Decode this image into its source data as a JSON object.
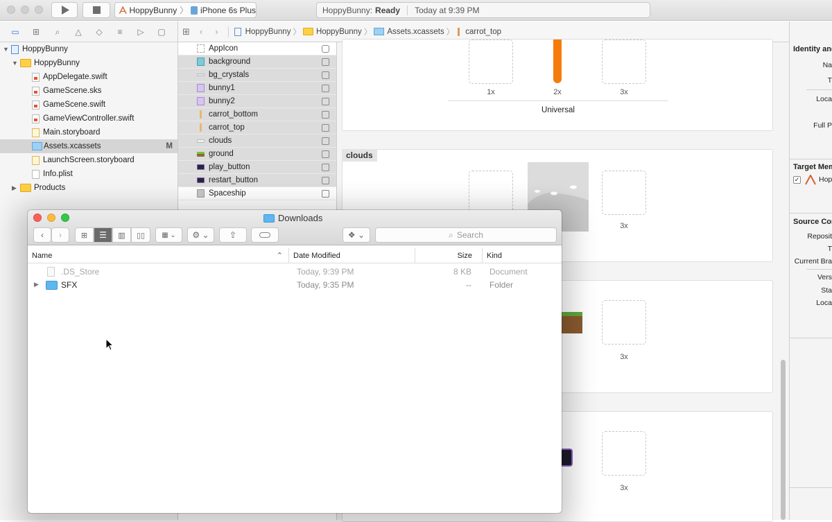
{
  "titlebar": {
    "scheme_app": "HoppyBunny",
    "scheme_device": "iPhone 6s Plus",
    "status_app": "HoppyBunny:",
    "status_state": "Ready",
    "status_time": "Today at 9:39 PM"
  },
  "jumpbar": {
    "crumbs": [
      "HoppyBunny",
      "HoppyBunny",
      "Assets.xcassets",
      "carrot_top"
    ]
  },
  "navigator": {
    "project": "HoppyBunny",
    "group": "HoppyBunny",
    "files": [
      "AppDelegate.swift",
      "GameScene.sks",
      "GameScene.swift",
      "GameViewController.swift",
      "Main.storyboard",
      "Assets.xcassets",
      "LaunchScreen.storyboard",
      "Info.plist"
    ],
    "selected_badge": "M",
    "products": "Products"
  },
  "assets": {
    "items": [
      "AppIcon",
      "background",
      "bg_crystals",
      "bunny1",
      "bunny2",
      "carrot_bottom",
      "carrot_top",
      "clouds",
      "ground",
      "play_button",
      "restart_button",
      "Spaceship"
    ]
  },
  "detail": {
    "slot_1x": "1x",
    "slot_2x": "2x",
    "slot_3x": "3x",
    "universal": "Universal",
    "universal_cut": "rsal",
    "clouds_set": "clouds"
  },
  "inspector": {
    "identity_head": "Identity and",
    "name_lbl": "Na",
    "type_lbl": "T",
    "location_lbl": "Loca",
    "full_lbl": "Full P",
    "target_head": "Target Mem",
    "target_item": "Hop",
    "source_head": "Source Con",
    "repo_lbl": "Reposit",
    "t2_lbl": "T",
    "branch_lbl": "Current Bra",
    "version_lbl": "Vers",
    "status_lbl": "Sta",
    "local_lbl": "Loca"
  },
  "finder": {
    "title": "Downloads",
    "search_placeholder": "Search",
    "columns": {
      "name": "Name",
      "date": "Date Modified",
      "size": "Size",
      "kind": "Kind"
    },
    "rows": [
      {
        "name": ".DS_Store",
        "date": "Today, 9:39 PM",
        "size": "8 KB",
        "kind": "Document"
      },
      {
        "name": "SFX",
        "date": "Today, 9:35 PM",
        "size": "--",
        "kind": "Folder"
      }
    ]
  },
  "colors": {
    "selection": "#d5d5d5",
    "folder_blue": "#5fb7ef",
    "carrot": "#f57c0a",
    "traffic_red": "#fc605b",
    "traffic_yellow": "#fdbc40",
    "traffic_green": "#34c84a"
  }
}
